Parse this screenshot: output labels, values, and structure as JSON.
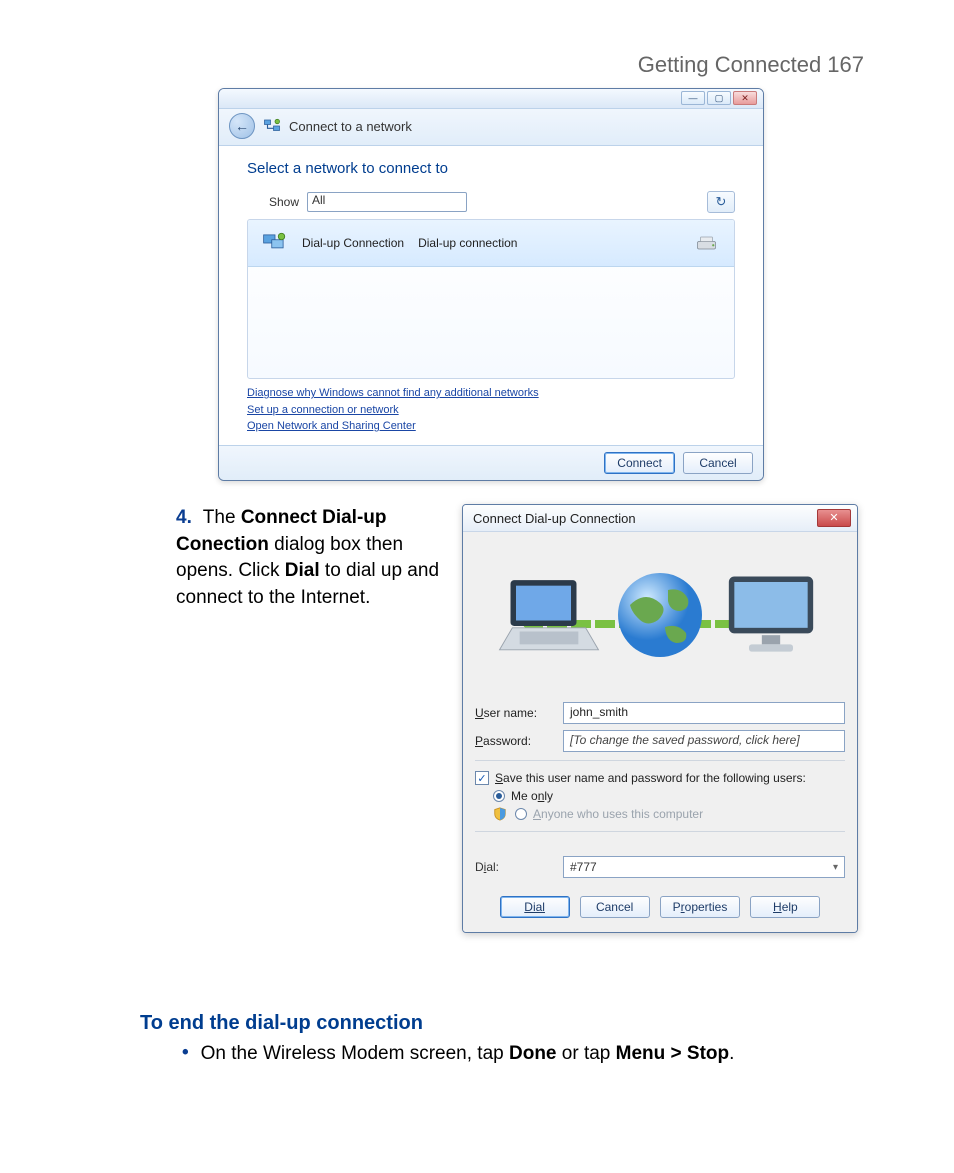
{
  "page": {
    "header": "Getting Connected  167"
  },
  "win1": {
    "title": "Connect to a network",
    "prompt": "Select a network to connect to",
    "show_label": "Show",
    "show_value": "All",
    "item": {
      "name": "Dial-up Connection",
      "type": "Dial-up connection"
    },
    "links": [
      "Diagnose why Windows cannot find any additional networks",
      "Set up a connection or network",
      "Open Network and Sharing Center"
    ],
    "connect": "Connect",
    "cancel": "Cancel",
    "minimize": "—",
    "maximize": "▢",
    "close": "✕",
    "back": "←",
    "refresh": "↻"
  },
  "step4": {
    "number": "4.",
    "pre": "The ",
    "bold1": "Connect Dial-up Conection",
    "mid1": " dialog box then opens. Click ",
    "bold2": "Dial",
    "post": " to dial up and connect to the Internet."
  },
  "win2": {
    "title": "Connect Dial-up Connection",
    "close": "✕",
    "username_label_pre": "U",
    "username_label_post": "ser name:",
    "username_value": "john_smith",
    "password_label_pre": "P",
    "password_label_post": "assword:",
    "password_placeholder": "[To change the saved password, click here]",
    "save_chk_pre": "S",
    "save_chk_post": "ave this user name and password for the following users:",
    "meonly_pre": "Me o",
    "meonly_u": "n",
    "meonly_post": "ly",
    "anyone_pre": "A",
    "anyone_post": "nyone who uses this computer",
    "dial_label_pre": "D",
    "dial_label_u": "i",
    "dial_label_post": "al:",
    "dial_value": "#777",
    "btn_dial": "Dial",
    "btn_cancel": "Cancel",
    "btn_properties": "Properties",
    "btn_help": "Help",
    "check": "✓"
  },
  "endsec": {
    "heading": "To end the dial-up connection",
    "dot": "•",
    "pre": "On the Wireless Modem screen, tap ",
    "bold1": "Done",
    "mid": " or tap ",
    "bold2": "Menu > Stop",
    "post": "."
  }
}
